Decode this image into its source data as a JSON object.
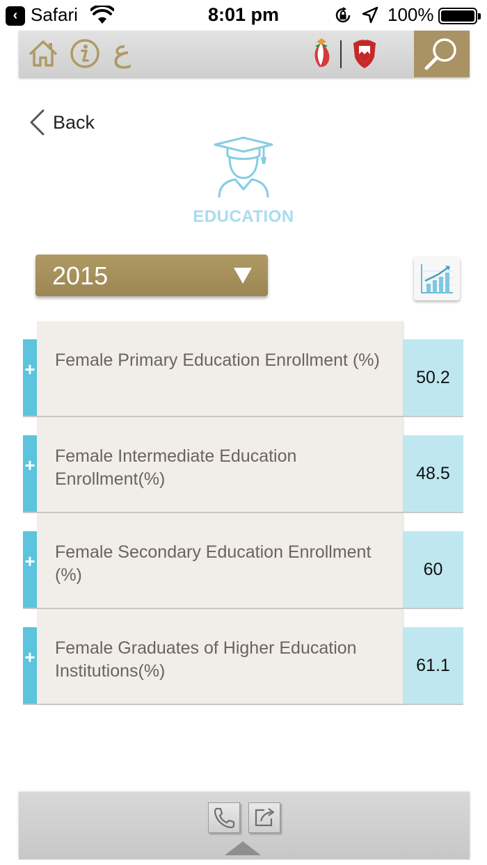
{
  "status_bar": {
    "app_name": "Safari",
    "time": "8:01 pm",
    "battery": "100%"
  },
  "toolbar": {
    "arabic_label": "ع"
  },
  "nav": {
    "back_label": "Back"
  },
  "category": {
    "title": "EDUCATION"
  },
  "year_selector": {
    "value": "2015"
  },
  "indicators": [
    {
      "label": "Female Primary Education Enrollment (%)",
      "value": "50.2"
    },
    {
      "label": "Female Intermediate Education Enrollment(%)",
      "value": "48.5"
    },
    {
      "label": "Female Secondary Education Enrollment (%)",
      "value": "60"
    },
    {
      "label": "Female Graduates of Higher Education Institutions(%)",
      "value": "61.1"
    }
  ],
  "colors": {
    "gold": "#a99263",
    "accent_blue": "#5cc4dc",
    "value_blue": "#bfe7f0",
    "card_beige": "#f1ede8",
    "title_blue": "#a9dcec"
  },
  "icons": {
    "status": [
      "back-to-app-icon",
      "wifi-icon",
      "rotation-lock-icon",
      "location-arrow-icon",
      "battery-icon"
    ],
    "toolbar": [
      "home-icon",
      "info-icon",
      "search-icon"
    ],
    "category": "graduate-icon",
    "chart": "chart-icon",
    "footer": [
      "phone-icon",
      "share-icon"
    ]
  }
}
